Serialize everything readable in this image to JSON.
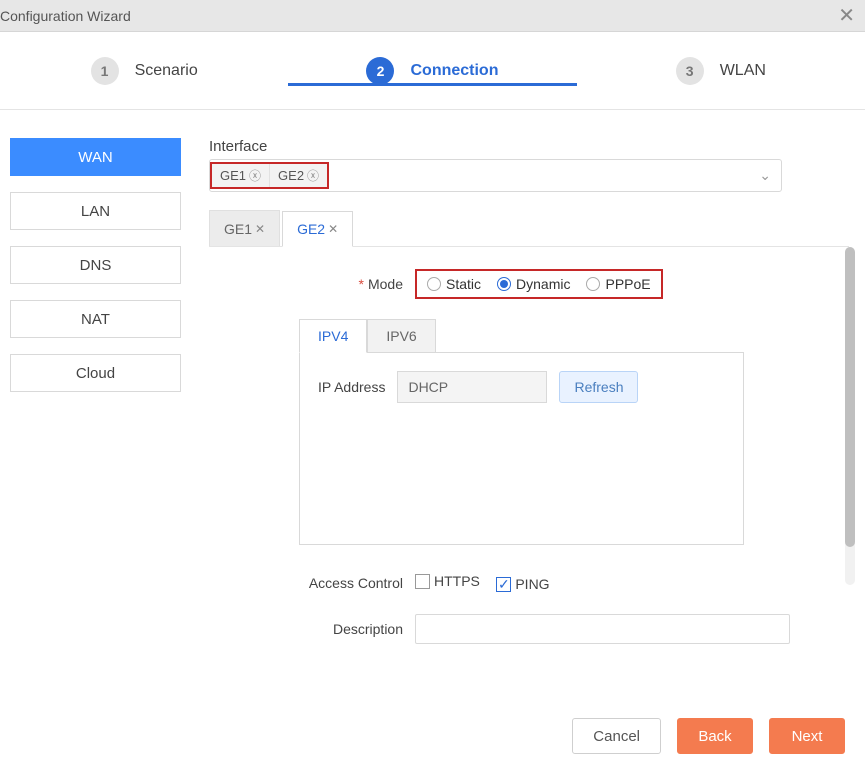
{
  "window": {
    "title": "Configuration Wizard"
  },
  "steps": [
    {
      "num": "1",
      "label": "Scenario"
    },
    {
      "num": "2",
      "label": "Connection"
    },
    {
      "num": "3",
      "label": "WLAN"
    }
  ],
  "active_step": 1,
  "sidebar": {
    "items": [
      {
        "label": "WAN"
      },
      {
        "label": "LAN"
      },
      {
        "label": "DNS"
      },
      {
        "label": "NAT"
      },
      {
        "label": "Cloud"
      }
    ],
    "active": 0
  },
  "interface": {
    "label": "Interface",
    "tags": [
      "GE1",
      "GE2"
    ]
  },
  "iface_tabs": [
    {
      "label": "GE1"
    },
    {
      "label": "GE2"
    }
  ],
  "active_iface_tab": 1,
  "mode": {
    "label": "Mode",
    "options": [
      "Static",
      "Dynamic",
      "PPPoE"
    ],
    "selected": 1
  },
  "ip_tabs": [
    "IPV4",
    "IPV6"
  ],
  "active_ip_tab": 0,
  "ip": {
    "address_label": "IP Address",
    "address_value": "DHCP",
    "refresh_label": "Refresh"
  },
  "access": {
    "label": "Access Control",
    "items": [
      {
        "label": "HTTPS",
        "checked": false
      },
      {
        "label": "PING",
        "checked": true
      }
    ]
  },
  "description_label": "Description",
  "footer": {
    "cancel": "Cancel",
    "back": "Back",
    "next": "Next"
  }
}
